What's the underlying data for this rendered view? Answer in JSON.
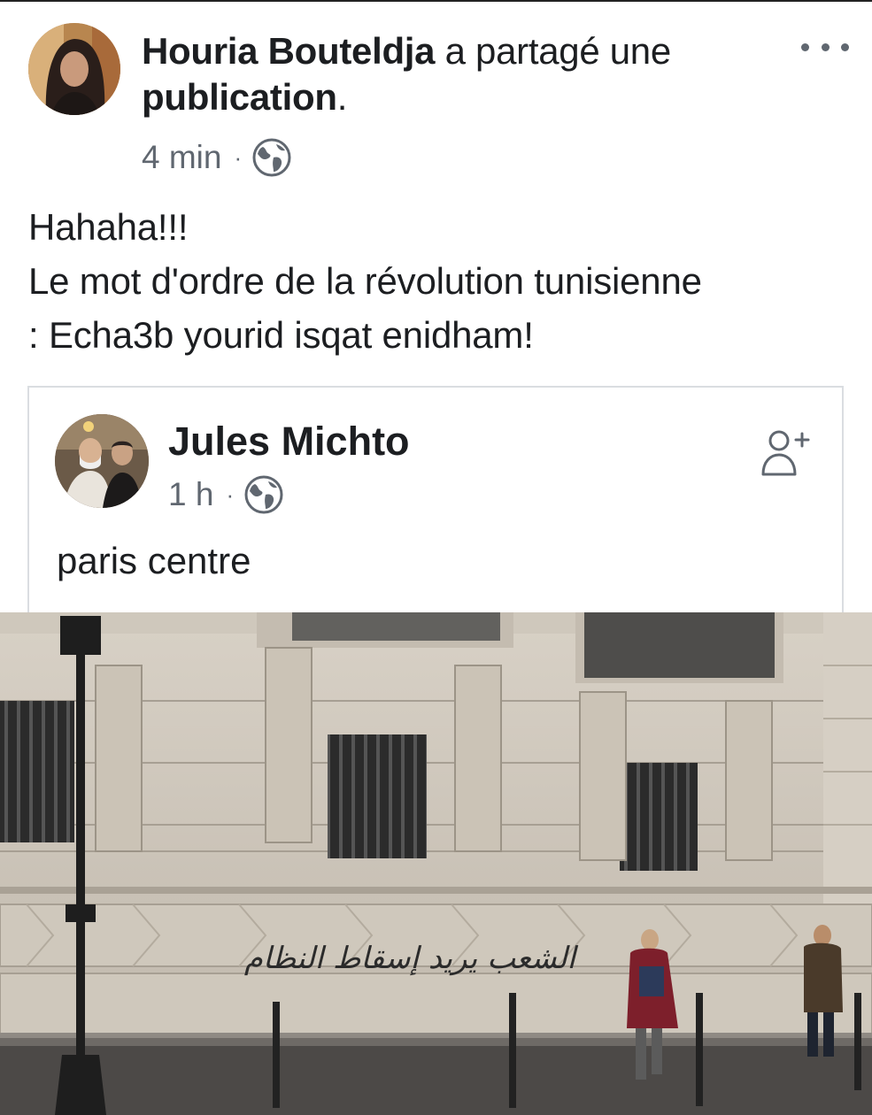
{
  "post": {
    "author": "Houria Bouteldja",
    "action_prefix": "a partagé une",
    "action_object": "publication",
    "action_suffix": ".",
    "time": "4 min",
    "separator": "·",
    "privacy_icon": "globe-icon",
    "more_icon": "more-options-icon",
    "text_lines": [
      "Hahaha!!!",
      "Le mot d'ordre de la révolution tunisienne",
      ": Echa3b yourid isqat enidham!"
    ]
  },
  "shared": {
    "author": "Jules Michto",
    "time": "1 h",
    "separator": "·",
    "privacy_icon": "globe-icon",
    "add_friend_icon": "add-friend-icon",
    "text": "paris centre"
  },
  "photo": {
    "graffiti": "الشعب يريد إسقاط النظام"
  },
  "colors": {
    "text": "#1c1e21",
    "meta": "#606770",
    "border": "#dadde1"
  }
}
